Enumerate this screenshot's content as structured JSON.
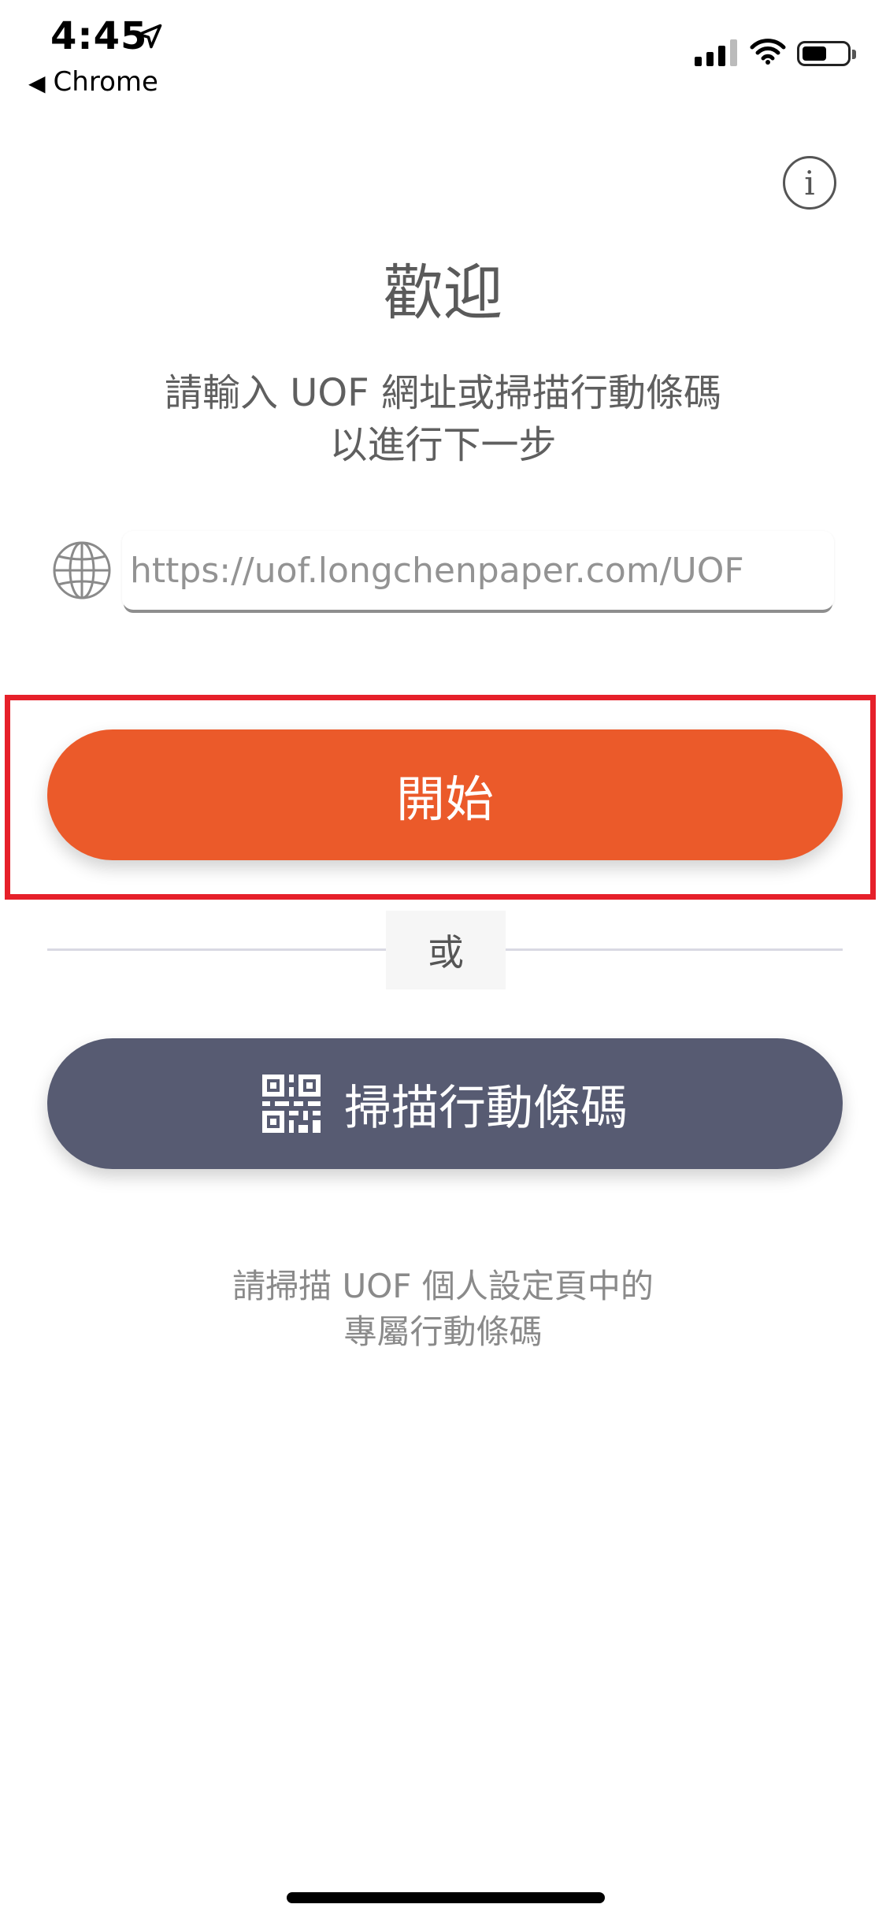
{
  "status_bar": {
    "time": "4:45",
    "back_app": "Chrome",
    "back_arrow": "◀"
  },
  "header": {
    "info_icon_glyph": "i"
  },
  "main": {
    "title": "歡迎",
    "subtitle_line1": "請輸入 UOF 網址或掃描行動條碼",
    "subtitle_line2": "以進行下一步",
    "url_input": {
      "value": "",
      "placeholder": "https://uof.longchenpaper.com/UOF"
    },
    "start_button": "開始",
    "or_label": "或",
    "scan_button": "掃描行動條碼",
    "hint_line1": "請掃描 UOF 個人設定頁中的",
    "hint_line2": "專屬行動條碼"
  },
  "colors": {
    "start_button": "#eb5a2a",
    "scan_button": "#575b72",
    "highlight_border": "#e6202a"
  }
}
